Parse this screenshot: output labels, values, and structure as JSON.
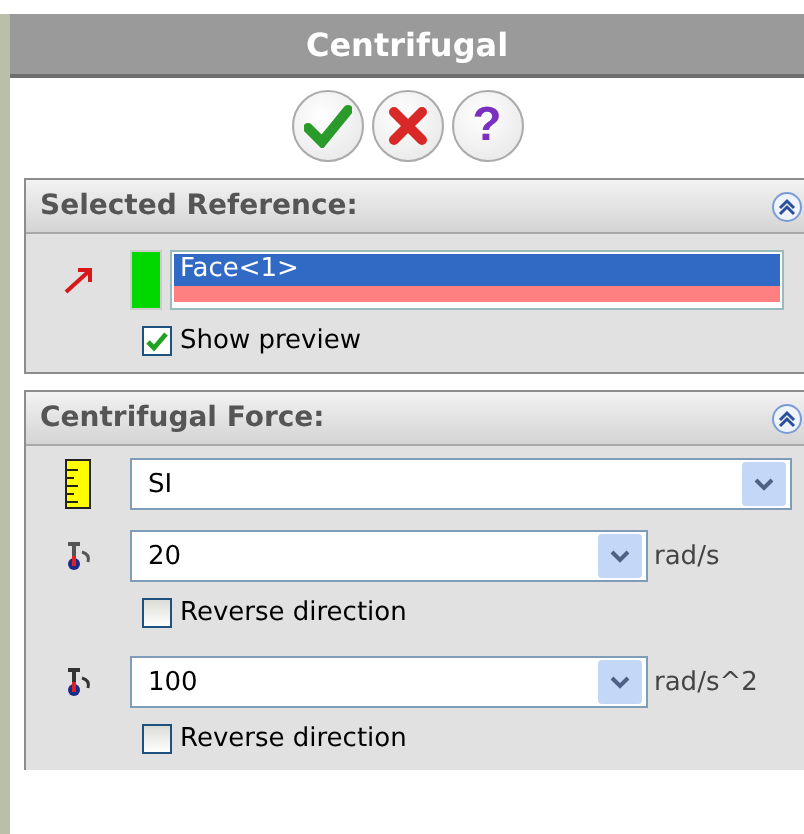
{
  "title": "Centrifugal",
  "actions": [
    {
      "kind": "ok"
    },
    {
      "kind": "cancel"
    },
    {
      "kind": "help",
      "symbol": "?"
    }
  ],
  "selected_reference": {
    "title": "Selected Reference:",
    "expanded": true,
    "reference": "Face<1>",
    "show_preview": {
      "label": "Show preview",
      "checked": true
    }
  },
  "centrifugal_force": {
    "title": "Centrifugal Force:",
    "expanded": true,
    "unit_system": "SI",
    "inputs": [
      {
        "kind": "velocity",
        "value": "20",
        "unit": "rad/s",
        "reverse": {
          "label": "Reverse direction",
          "checked": false
        }
      },
      {
        "kind": "acceleration",
        "value": "100",
        "unit": "rad/s^2",
        "reverse": {
          "label": "Reverse direction",
          "checked": false
        }
      }
    ]
  }
}
